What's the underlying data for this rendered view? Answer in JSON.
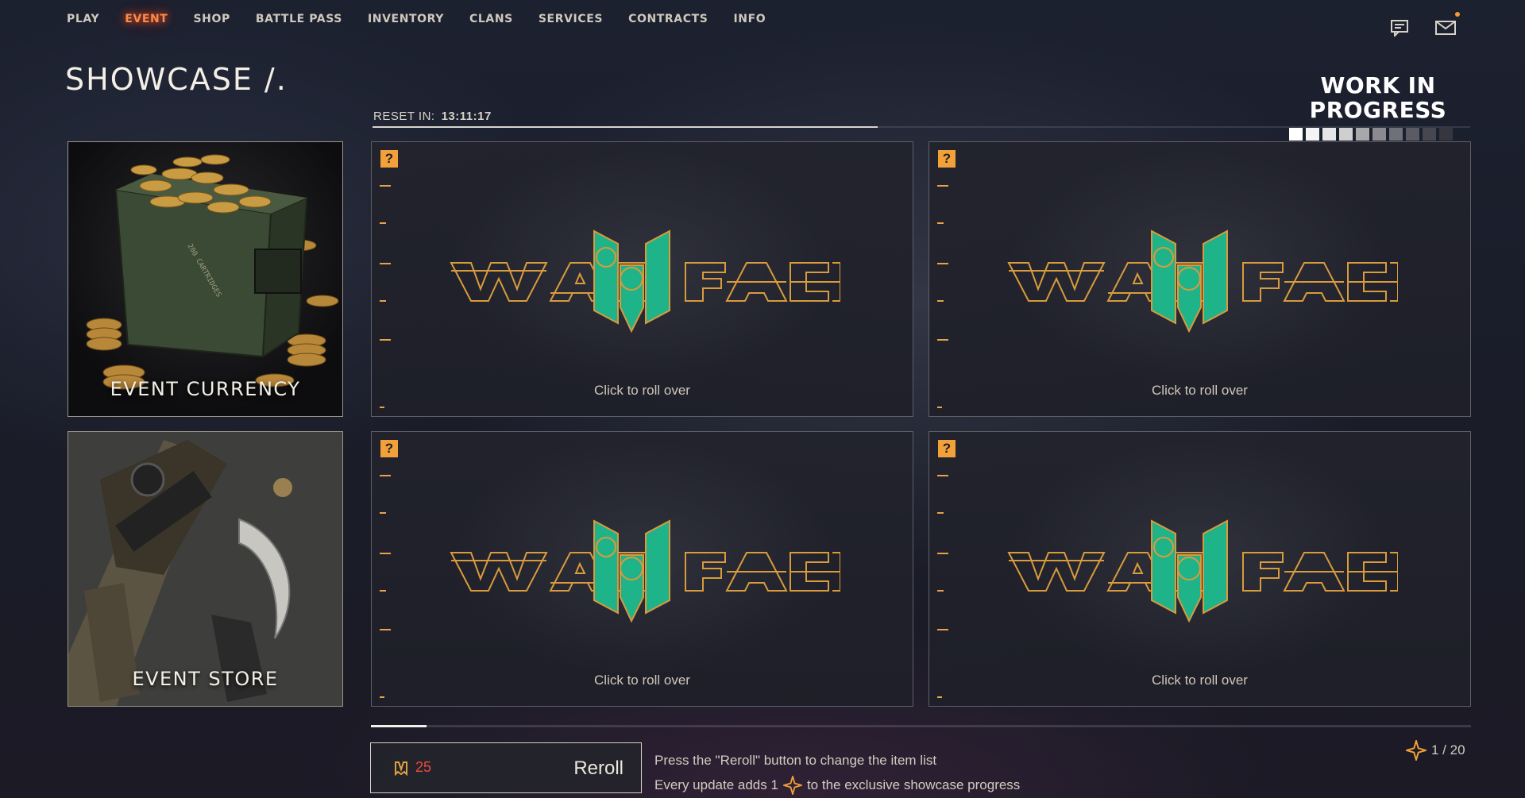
{
  "nav": {
    "items": [
      {
        "label": "PLAY"
      },
      {
        "label": "EVENT"
      },
      {
        "label": "SHOP"
      },
      {
        "label": "BATTLE PASS"
      },
      {
        "label": "INVENTORY"
      },
      {
        "label": "CLANS"
      },
      {
        "label": "SERVICES"
      },
      {
        "label": "CONTRACTS"
      },
      {
        "label": "INFO"
      }
    ],
    "active": "EVENT",
    "icons": [
      "chat-icon",
      "mail-icon"
    ]
  },
  "page": {
    "title": "SHOWCASE /."
  },
  "reset": {
    "label": "RESET IN:",
    "time": "13:11:17",
    "progress": 0.46
  },
  "wip_badge": {
    "text": "WORK IN\nPROGRESS",
    "filled_segments": 4,
    "total_segments": 10
  },
  "tiles": [
    {
      "label": "EVENT CURRENCY"
    },
    {
      "label": "EVENT STORE"
    }
  ],
  "cards": [
    {
      "badge": "?",
      "action": "Click to roll over",
      "logo": "WARFACE"
    },
    {
      "badge": "?",
      "action": "Click to roll over",
      "logo": "WARFACE"
    },
    {
      "badge": "?",
      "action": "Click to roll over",
      "logo": "WARFACE"
    },
    {
      "badge": "?",
      "action": "Click to roll over",
      "logo": "WARFACE"
    }
  ],
  "carousel": {
    "page_fraction": 0.05
  },
  "reroll": {
    "cost": "25",
    "label": "Reroll",
    "cost_icon": "voucher-icon"
  },
  "hints": {
    "line1": "Press the \"Reroll\" button to change the item list",
    "line2_before": "Every update adds 1",
    "line2_after": "to the exclusive showcase progress"
  },
  "progress": {
    "text": "1 / 20",
    "icon": "star-icon"
  },
  "colors": {
    "accent_orange": "#f2a03a",
    "active_nav": "#ff8a47",
    "teal_logo": "#1fb38a",
    "cost_red": "#ef4a3a"
  }
}
